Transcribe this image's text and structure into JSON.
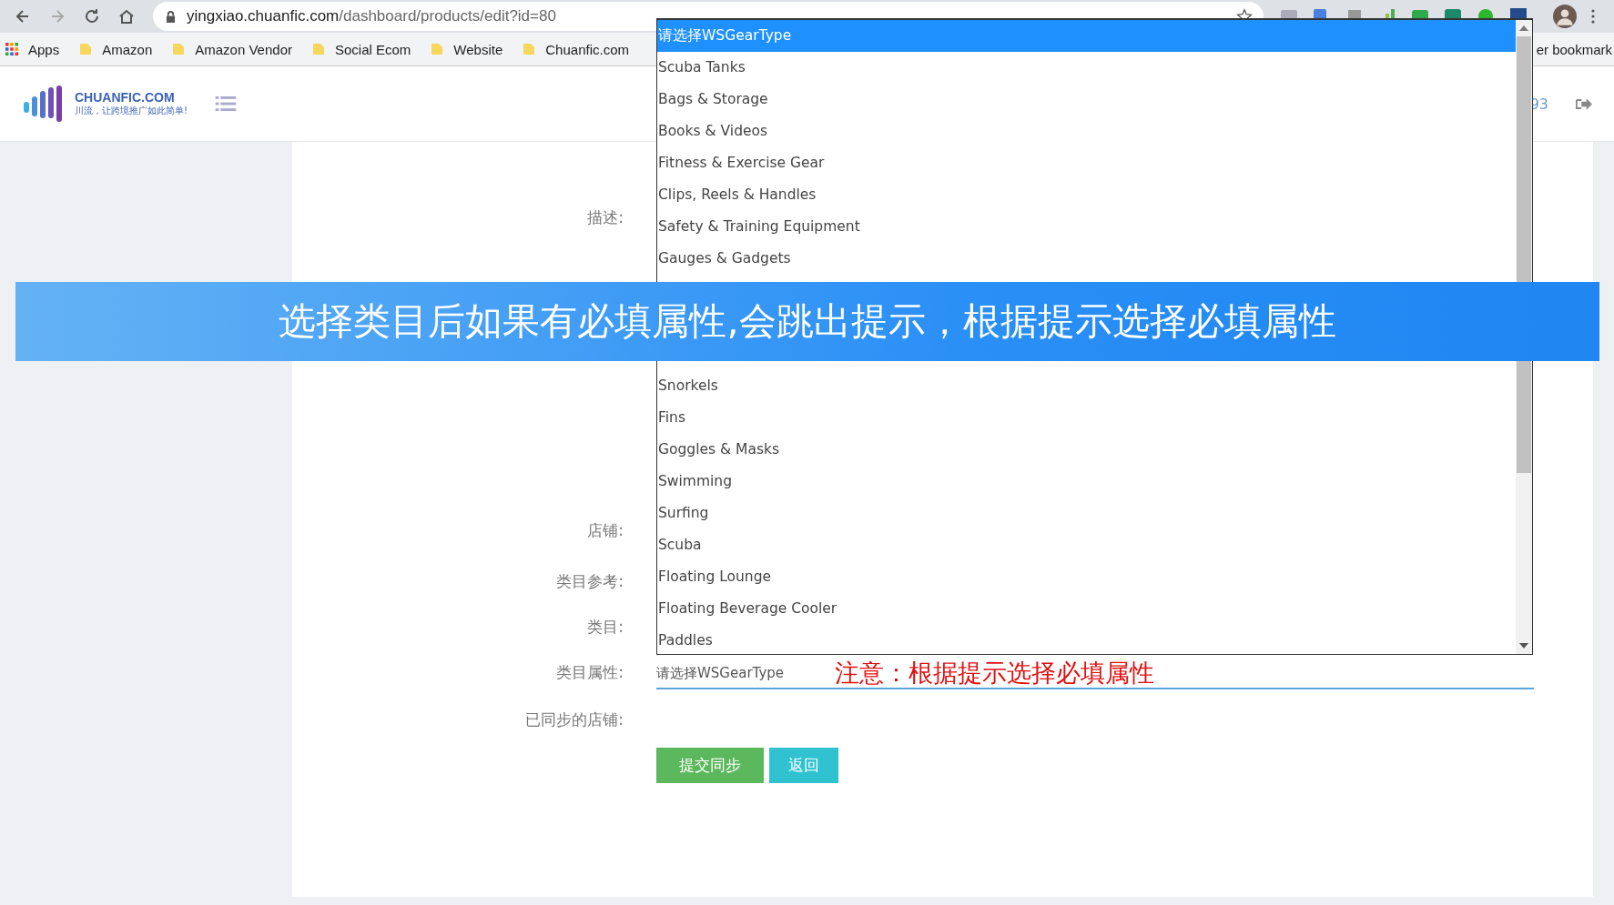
{
  "browser": {
    "url_host": "yingxiao.chuanfic.com",
    "url_path": "/dashboard/products/edit?id=80",
    "bookmarks": [
      {
        "label": "Apps",
        "kind": "apps"
      },
      {
        "label": "Amazon",
        "kind": "folder"
      },
      {
        "label": "Amazon Vendor",
        "kind": "folder"
      },
      {
        "label": "Social Ecom",
        "kind": "folder"
      },
      {
        "label": "Website",
        "kind": "folder"
      },
      {
        "label": "Chuanfic.com",
        "kind": "folder"
      }
    ],
    "other_bookmarks": "er bookmark"
  },
  "header": {
    "logo_text": "CHUANFIC.COM",
    "logo_slogan": "川流，让跨境推广如此简单!",
    "user_fragment": "93"
  },
  "form": {
    "labels": [
      {
        "text": "描述:",
        "kind": "description"
      },
      {
        "text": "店铺:",
        "kind": "store"
      },
      {
        "text": "类目参考:",
        "kind": "ref"
      },
      {
        "text": "类目:",
        "kind": "category"
      },
      {
        "text": "类目属性:",
        "kind": "attr"
      },
      {
        "text": "已同步的店铺:",
        "kind": "synced"
      }
    ],
    "attribute_select": {
      "value": "请选择WSGearType"
    },
    "note": "注意：根据提示选择必填属性",
    "buttons": [
      {
        "label": "提交同步",
        "kind": "primary"
      },
      {
        "label": "返回",
        "kind": "info"
      }
    ]
  },
  "dropdown": {
    "options_top": [
      {
        "label": "请选择WSGearType",
        "selected": true
      },
      {
        "label": "Scuba Tanks",
        "selected": false
      },
      {
        "label": "Bags & Storage",
        "selected": false
      },
      {
        "label": "Books & Videos",
        "selected": false
      },
      {
        "label": "Fitness & Exercise Gear",
        "selected": false
      },
      {
        "label": "Clips, Reels & Handles",
        "selected": false
      },
      {
        "label": "Safety & Training Equipment",
        "selected": false
      },
      {
        "label": "Gauges & Gadgets",
        "selected": false
      }
    ],
    "options_bottom": [
      {
        "label": "Snorkels",
        "selected": false
      },
      {
        "label": "Fins",
        "selected": false
      },
      {
        "label": "Goggles & Masks",
        "selected": false
      },
      {
        "label": "Swimming",
        "selected": false
      },
      {
        "label": "Surfing",
        "selected": false
      },
      {
        "label": "Scuba",
        "selected": false
      },
      {
        "label": "Floating Lounge",
        "selected": false
      },
      {
        "label": "Floating Beverage Cooler",
        "selected": false
      },
      {
        "label": "Paddles",
        "selected": false
      }
    ]
  },
  "banner": {
    "text": "选择类目后如果有必填属性,会跳出提示，根据提示选择必填属性"
  }
}
